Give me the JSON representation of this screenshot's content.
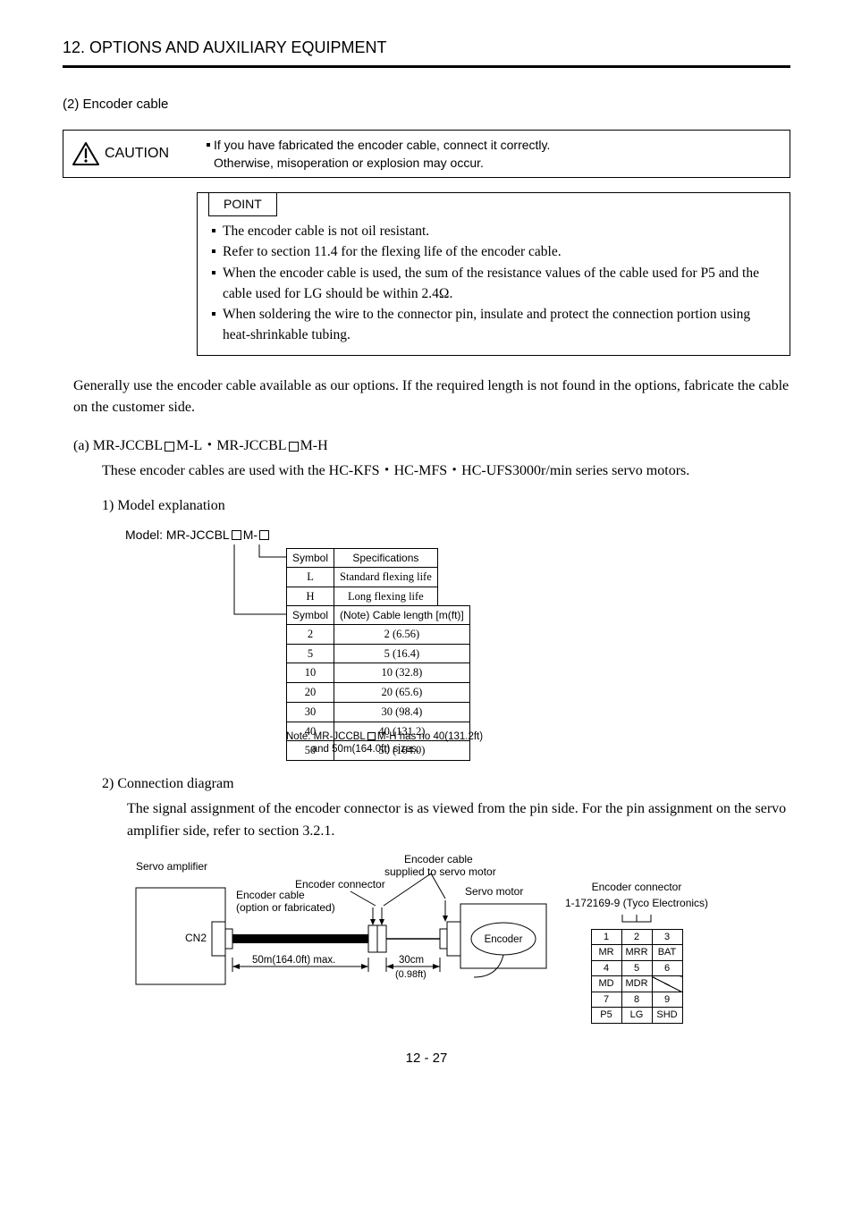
{
  "section_title": "12. OPTIONS AND AUXILIARY EQUIPMENT",
  "subsection_label": "(2) Encoder cable",
  "caution": {
    "word": "CAUTION",
    "text_line1": "If you have fabricated the encoder cable, connect it correctly.",
    "text_line2": "Otherwise, misoperation or explosion may occur."
  },
  "point": {
    "label": "POINT",
    "items": [
      "The encoder cable is not oil resistant.",
      "Refer to section 11.4 for the flexing life of the encoder cable.",
      "When the encoder cable is used, the sum of the resistance values of the cable used for P5 and the cable used for LG should be within 2.4Ω.",
      "When soldering the wire to the connector pin, insulate and protect the connection portion using heat-shrinkable tubing."
    ]
  },
  "body_para": "Generally use the encoder cable available as our options. If the required length is not found in the options, fabricate the cable on the customer side.",
  "sub_a": {
    "heading_pre": "(a) MR-JCCBL",
    "heading_mid": "M-L・MR-JCCBL",
    "heading_post": "M-H",
    "body": "These encoder cables are used with the HC-KFS・HC-MFS・HC-UFS3000r/min series servo motors."
  },
  "sub_1": {
    "heading": "1) Model explanation",
    "model_label_pre": "Model: MR-JCCBL",
    "model_label_mid": " M-",
    "spec_table": {
      "header": [
        "Symbol",
        "Specifications"
      ],
      "rows": [
        [
          "L",
          "Standard flexing life"
        ],
        [
          "H",
          "Long flexing life"
        ]
      ]
    },
    "len_table": {
      "header": [
        "Symbol",
        "(Note) Cable length [m(ft)]"
      ],
      "rows": [
        [
          "2",
          "2 (6.56)"
        ],
        [
          "5",
          "5 (16.4)"
        ],
        [
          "10",
          "10 (32.8)"
        ],
        [
          "20",
          "20 (65.6)"
        ],
        [
          "30",
          "30 (98.4)"
        ],
        [
          "40",
          "40 (131.2)"
        ],
        [
          "50",
          "50 (164.0)"
        ]
      ]
    },
    "note_line1_pre": "Note. MR-JCCBL",
    "note_line1_post": "M-H has no 40(131.2ft)",
    "note_line2": "and 50m(164.0ft) sizes."
  },
  "sub_2": {
    "heading": "2) Connection diagram",
    "body": "The signal assignment of the encoder connector is as viewed from the pin side. For the pin assignment on the servo amplifier side, refer to section 3.2.1."
  },
  "diagram": {
    "labels": {
      "servo_amplifier": "Servo amplifier",
      "cn2": "CN2",
      "enc_cable_line1": "Encoder cable",
      "enc_cable_line2": "(option or fabricated)",
      "fifty_m": "50m(164.0ft) max.",
      "thirty_cm": "30cm",
      "thirty_cm_sub": "(0.98ft)",
      "enc_connector": "Encoder connector",
      "supplied_line1": "Encoder cable",
      "supplied_line2": "supplied to servo motor",
      "servo_motor": "Servo motor",
      "encoder": "Encoder",
      "right_conn_line1": "Encoder connector",
      "right_conn_line2": "1-172169-9 (Tyco Electronics)"
    },
    "pin_table": [
      [
        "1",
        "2",
        "3"
      ],
      [
        "MR",
        "MRR",
        "BAT"
      ],
      [
        "4",
        "5",
        "6"
      ],
      [
        "MD",
        "MDR",
        ""
      ],
      [
        "7",
        "8",
        "9"
      ],
      [
        "P5",
        "LG",
        "SHD"
      ]
    ],
    "pin_table_slash": {
      "row": 3,
      "col": 2
    }
  },
  "page_number": "12 -  27"
}
